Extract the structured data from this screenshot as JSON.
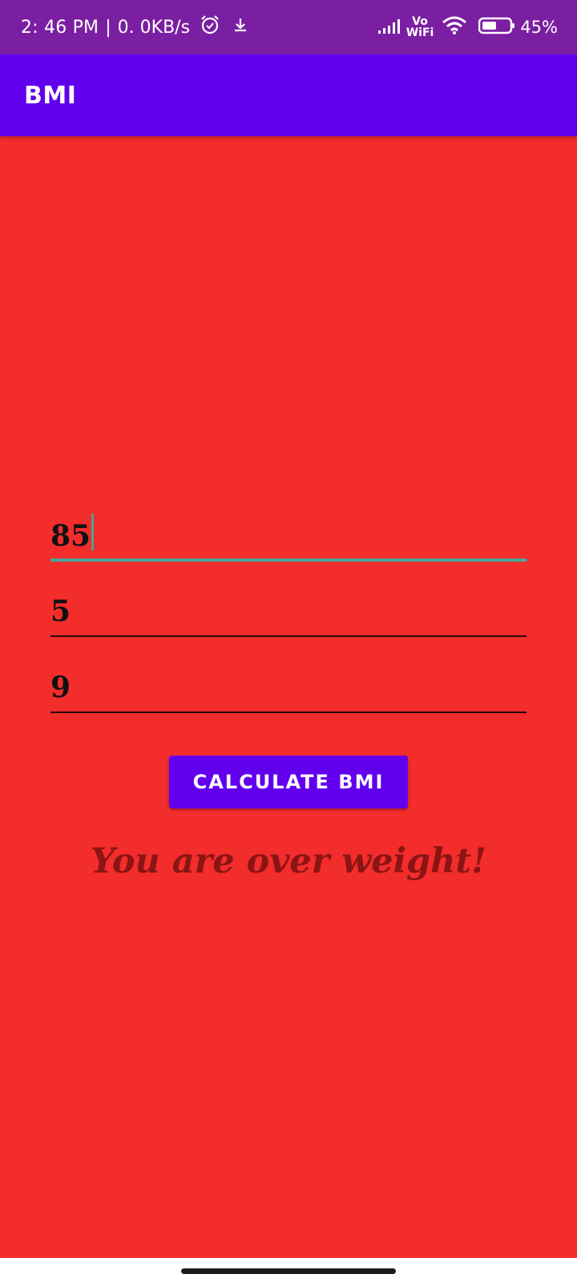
{
  "status_bar": {
    "time": "2: 46 PM",
    "separator": "|",
    "speed": "0. 0KB/s",
    "vo": "Vo",
    "wifi": "WiFi",
    "battery": "45%",
    "icons": [
      "alarm-icon",
      "download-icon",
      "signal-icon",
      "wifi-icon",
      "battery-icon"
    ]
  },
  "app_bar": {
    "title": "BMI",
    "color": "#6200ee"
  },
  "form": {
    "weight": "85",
    "height_feet": "5",
    "height_inches": "9"
  },
  "button": {
    "label": "CALCULATE BMI"
  },
  "result": {
    "message": "You are over weight!"
  },
  "colors": {
    "background": "#f32c2c",
    "status_bar": "#7b1fa2",
    "accent": "#4aa59a",
    "result_text": "#8b1414"
  }
}
